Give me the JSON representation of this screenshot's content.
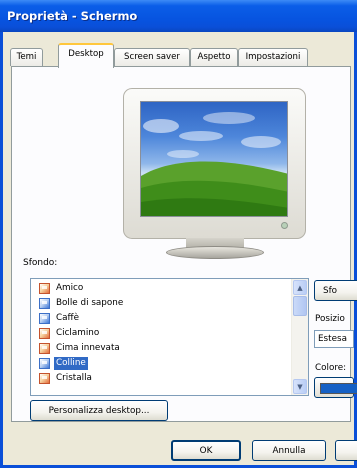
{
  "window": {
    "title": "Proprietà - Schermo"
  },
  "tabs": [
    {
      "label": "Temi",
      "active": false
    },
    {
      "label": "Desktop",
      "active": true
    },
    {
      "label": "Screen saver",
      "active": false
    },
    {
      "label": "Aspetto",
      "active": false
    },
    {
      "label": "Impostazioni",
      "active": false
    }
  ],
  "background": {
    "label": "Sfondo:",
    "items": [
      {
        "label": "Amico",
        "icon": "image-file-icon"
      },
      {
        "label": "Bolle di sapone",
        "icon": "image-file-blue-icon"
      },
      {
        "label": "Caffè",
        "icon": "image-file-blue-icon"
      },
      {
        "label": "Ciclamino",
        "icon": "image-file-icon"
      },
      {
        "label": "Cima innevata",
        "icon": "image-file-icon"
      },
      {
        "label": "Colline",
        "icon": "image-file-blue-icon",
        "selected": true
      },
      {
        "label": "Cristalla",
        "icon": "image-file-icon"
      }
    ]
  },
  "side": {
    "browse_label": "Sfo",
    "position_label": "Posizio",
    "position_value": "Estesa",
    "color_label": "Colore:",
    "color_value": "#1560c4"
  },
  "buttons": {
    "customize_label": "Personalizza desktop...",
    "ok_label": "OK",
    "cancel_label": "Annulla"
  },
  "colors": {
    "titlebar": "#0a4fd8",
    "selection": "#316ac5",
    "window_face": "#ece9d8",
    "active_tab_accent": "#ffc73c"
  }
}
